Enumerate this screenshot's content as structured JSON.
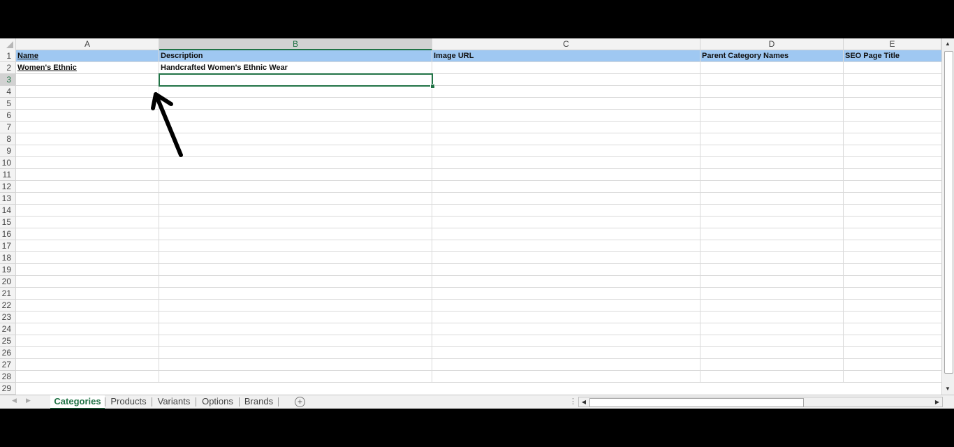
{
  "columns": [
    "A",
    "B",
    "C",
    "D",
    "E"
  ],
  "selected_column": "B",
  "rows": [
    "1",
    "2",
    "3",
    "4",
    "5",
    "6",
    "7",
    "8",
    "9",
    "10",
    "11",
    "12",
    "13",
    "14",
    "15",
    "16",
    "17",
    "18",
    "19",
    "20",
    "21",
    "22",
    "23",
    "24",
    "25",
    "26",
    "27",
    "28",
    "29"
  ],
  "selected_row": "3",
  "header_row": {
    "a": "Name",
    "b": "Description",
    "c": "Image URL",
    "d": "Parent Category Names",
    "e": "SEO Page Title"
  },
  "data_row_2": {
    "a": "Women's Ethnic",
    "b": "Handcrafted Women's Ethnic Wear"
  },
  "active_cell": "B3",
  "tabs": {
    "categories": "Categories",
    "products": "Products",
    "variants": "Variants",
    "options": "Options",
    "brands": "Brands",
    "active": "Categories"
  },
  "colors": {
    "header_band": "#9fc8f2",
    "accent_green": "#217346"
  },
  "icons": {
    "add_sheet": "plus-circle-icon",
    "annotation": "arrow-annotation-icon"
  }
}
